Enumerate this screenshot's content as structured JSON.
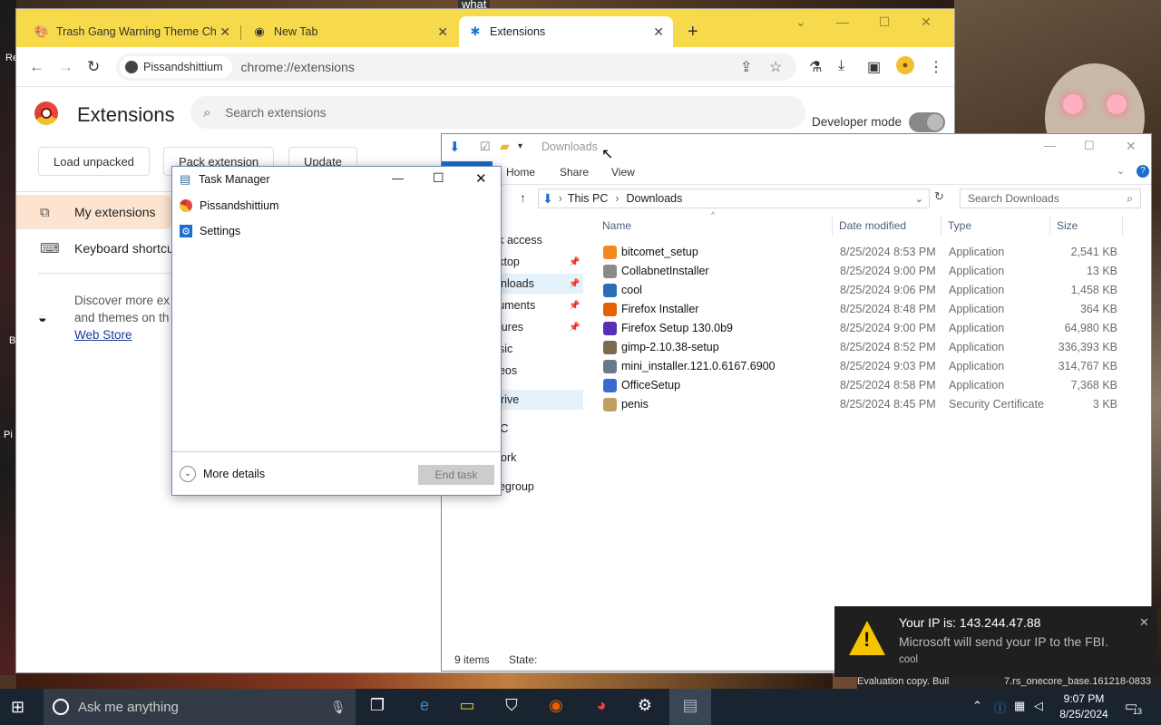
{
  "chrome": {
    "tabs": [
      {
        "label": "Trash Gang Warning Theme Ch",
        "icon": "theme-icon"
      },
      {
        "label": "New Tab",
        "icon": "chrome-icon"
      },
      {
        "label": "Extensions",
        "icon": "puzzle-icon"
      }
    ],
    "profile_chip": "Pissandshittium",
    "url": "chrome://extensions"
  },
  "extensions_page": {
    "title": "Extensions",
    "search_placeholder": "Search extensions",
    "developer_mode_label": "Developer mode",
    "developer_mode": true,
    "buttons": [
      "Load unpacked",
      "Pack extension",
      "Update"
    ],
    "nav": [
      {
        "label": "My extensions"
      },
      {
        "label": "Keyboard shortcu"
      }
    ],
    "discover_line1": "Discover more ex",
    "discover_line2": "and themes on th",
    "web_store_link": "Web Store"
  },
  "explorer": {
    "title": "Downloads",
    "ribbon_tabs": [
      "Home",
      "Share",
      "View"
    ],
    "breadcrumb": [
      "This PC",
      "Downloads"
    ],
    "search_placeholder": "Search Downloads",
    "nav_items": [
      "ck access",
      "sktop",
      "wnloads",
      "cuments",
      "ctures",
      "usic",
      "deos",
      "Drive",
      "PC",
      "work",
      "negroup"
    ],
    "columns": [
      "Name",
      "Date modified",
      "Type",
      "Size"
    ],
    "files": [
      {
        "name": "bitcomet_setup",
        "date": "8/25/2024 8:53 PM",
        "type": "Application",
        "size": "2,541 KB",
        "color": "#f08a1c"
      },
      {
        "name": "CollabnetInstaller",
        "date": "8/25/2024 9:00 PM",
        "type": "Application",
        "size": "13 KB",
        "color": "#8a8a8a"
      },
      {
        "name": "cool",
        "date": "8/25/2024 9:06 PM",
        "type": "Application",
        "size": "1,458 KB",
        "color": "#2d6db5"
      },
      {
        "name": "Firefox Installer",
        "date": "8/25/2024 8:48 PM",
        "type": "Application",
        "size": "364 KB",
        "color": "#e66000"
      },
      {
        "name": "Firefox Setup 130.0b9",
        "date": "8/25/2024 9:00 PM",
        "type": "Application",
        "size": "64,980 KB",
        "color": "#5a2db5"
      },
      {
        "name": "gimp-2.10.38-setup",
        "date": "8/25/2024 8:52 PM",
        "type": "Application",
        "size": "336,393 KB",
        "color": "#7a6a50"
      },
      {
        "name": "mini_installer.121.0.6167.6900",
        "date": "8/25/2024 9:03 PM",
        "type": "Application",
        "size": "314,767 KB",
        "color": "#6a7a8a"
      },
      {
        "name": "OfficeSetup",
        "date": "8/25/2024 8:58 PM",
        "type": "Application",
        "size": "7,368 KB",
        "color": "#3a6ad0"
      },
      {
        "name": "penis",
        "date": "8/25/2024 8:45 PM",
        "type": "Security Certificate",
        "size": "3 KB",
        "color": "#c0a060"
      }
    ],
    "status_items": "9 items",
    "status_state": "State:"
  },
  "task_manager": {
    "title": "Task Manager",
    "items": [
      {
        "label": "Pissandshittium",
        "icon": "pissandshittium-icon"
      },
      {
        "label": "Settings",
        "icon": "settings-gear-icon"
      }
    ],
    "more_details": "More details",
    "end_task": "End task"
  },
  "toast": {
    "title": "Your IP is: 143.244.47.88",
    "message": "Microsoft will send your IP to the FBI.",
    "source": "cool"
  },
  "taskbar": {
    "search_placeholder": "Ask me anything",
    "time": "9:07 PM",
    "date": "8/25/2024",
    "notification_count": "13",
    "watermark": "Evaluation copy. Buil",
    "build": "7.rs_onecore_base.161218-0833"
  },
  "desktop": {
    "icon_label_1": "Re",
    "icon_label_2": "B",
    "icon_label_3": "Pi",
    "banner_text": "what"
  }
}
